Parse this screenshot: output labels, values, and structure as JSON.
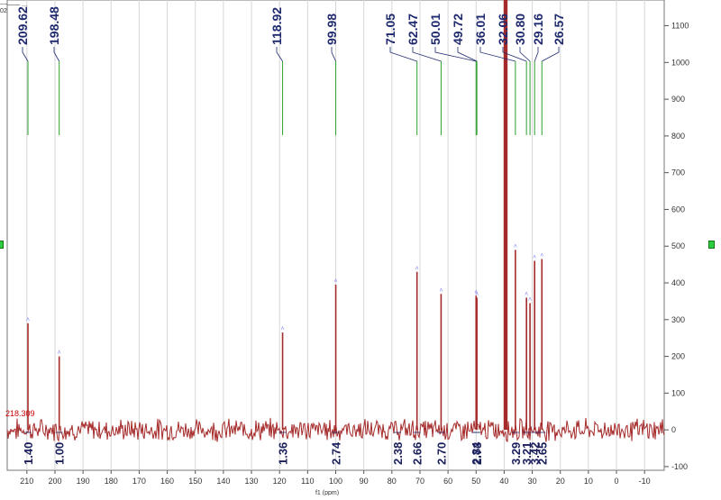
{
  "header": {
    "line1": "~~—— ...",
    "line2": "02"
  },
  "colors": {
    "spectrum": "#a52a2a",
    "peak_label": "#1f2a6e",
    "peak_line": "#2ca02c",
    "axis_label": "#1a1f5c",
    "cursor": "#cc0000",
    "handle": "#2ecc40"
  },
  "chart_data": {
    "type": "line",
    "title": "",
    "xlabel": "f1 (ppm)",
    "ylabel": "",
    "xlim": [
      217,
      -17
    ],
    "ylim": [
      -110,
      1170
    ],
    "x_reversed": true,
    "grid": true,
    "x_ticks": [
      "210",
      "200",
      "190",
      "180",
      "170",
      "160",
      "150",
      "140",
      "130",
      "120",
      "110",
      "100",
      "90",
      "80",
      "70",
      "60",
      "50",
      "40",
      "30",
      "20",
      "10",
      "0",
      "-10"
    ],
    "y_ticks": [
      "1100",
      "1000",
      "900",
      "800",
      "700",
      "600",
      "500",
      "400",
      "300",
      "200",
      "100",
      "0",
      "-100"
    ],
    "cursor_readout": "218.309",
    "peaks": [
      {
        "ppm": 209.62,
        "label": "209.62",
        "height": 290
      },
      {
        "ppm": 198.48,
        "label": "198.48",
        "height": 200
      },
      {
        "ppm": 118.92,
        "label": "118.92",
        "height": 265
      },
      {
        "ppm": 99.98,
        "label": "99.98",
        "height": 395
      },
      {
        "ppm": 71.05,
        "label": "71.05",
        "height": 430
      },
      {
        "ppm": 62.47,
        "label": "62.47",
        "height": 370
      },
      {
        "ppm": 50.01,
        "label": "50.01",
        "height": 365
      },
      {
        "ppm": 49.72,
        "label": "49.72",
        "height": 360
      },
      {
        "ppm": 36.01,
        "label": "36.01",
        "height": 490
      },
      {
        "ppm": 32.06,
        "label": "32.06",
        "height": 360
      },
      {
        "ppm": 30.8,
        "label": "30.80",
        "height": 345
      },
      {
        "ppm": 29.16,
        "label": "29.16",
        "height": 460
      },
      {
        "ppm": 26.57,
        "label": "26.57",
        "height": 465
      }
    ],
    "solvent_peak": {
      "ppm": 39.5,
      "height": 1170
    },
    "integrals": [
      {
        "ppm": 209.62,
        "label": "1.40"
      },
      {
        "ppm": 198.48,
        "label": "1.00"
      },
      {
        "ppm": 118.92,
        "label": "1.36"
      },
      {
        "ppm": 99.98,
        "label": "2.74"
      },
      {
        "ppm": 71.05,
        "label": "2.66"
      },
      {
        "ppm": 62.47,
        "label": "2.70"
      },
      {
        "ppm": 50.01,
        "label": "2.84"
      },
      {
        "ppm": 49.72,
        "label": "2.73"
      },
      {
        "ppm": 36.01,
        "label": "3.29"
      },
      {
        "ppm": 32.06,
        "label": "3.21"
      },
      {
        "ppm": 29.16,
        "label": "3.42"
      },
      {
        "ppm": 26.57,
        "label": "2.65"
      },
      {
        "ppm": 78.0,
        "label": "2.38"
      }
    ]
  }
}
